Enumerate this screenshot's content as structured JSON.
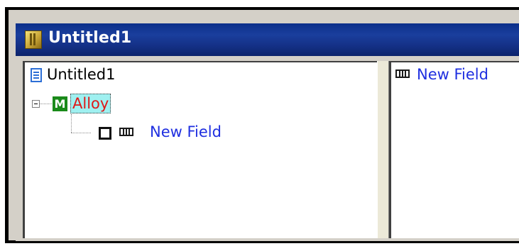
{
  "window": {
    "title": "Untitled1"
  },
  "tree": {
    "root": {
      "label": "Untitled1",
      "icon": "document-icon"
    },
    "model": {
      "label": "Alloy",
      "icon": "model-m-icon",
      "badge_letter": "M",
      "selected": true
    },
    "field": {
      "label": "New Field",
      "icon": "field-icon"
    }
  },
  "right_pane": {
    "items": [
      {
        "label": "New Field",
        "icon": "field-icon"
      }
    ]
  },
  "colors": {
    "titlebar": "#153289",
    "link_text": "#1f2fe0",
    "selected_text": "#e01818",
    "selected_bg": "#9ff0f0",
    "model_icon": "#1a8a1a",
    "document_icon": "#2d6fd6"
  }
}
